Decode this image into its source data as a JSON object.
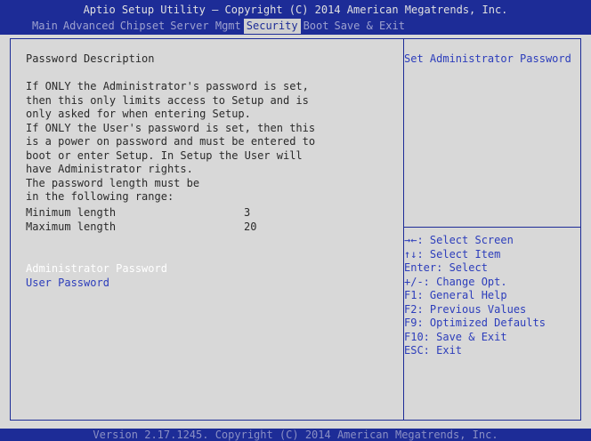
{
  "header": {
    "title": "Aptio Setup Utility – Copyright (C) 2014 American Megatrends, Inc."
  },
  "menu": {
    "items": [
      {
        "label": "Main"
      },
      {
        "label": "Advanced"
      },
      {
        "label": "Chipset"
      },
      {
        "label": "Server Mgmt"
      },
      {
        "label": "Security",
        "active": true
      },
      {
        "label": "Boot"
      },
      {
        "label": "Save & Exit"
      }
    ]
  },
  "main": {
    "heading": "Password Description",
    "description": "If ONLY the Administrator's password is set,\nthen this only limits access to Setup and is\nonly asked for when entering Setup.\nIf ONLY the User's password is set, then this\nis a power on password and must be entered to\nboot or enter Setup. In Setup the User will\nhave Administrator rights.\nThe password length must be\nin the following range:",
    "min_length_label": "Minimum length",
    "min_length_value": "3",
    "max_length_label": "Maximum length",
    "max_length_value": "20",
    "admin_password_label": "Administrator Password",
    "user_password_label": "User Password"
  },
  "help": {
    "text": "Set Administrator Password",
    "keys": "→←: Select Screen\n↑↓: Select Item\nEnter: Select\n+/-: Change Opt.\nF1: General Help\nF2: Previous Values\nF9: Optimized Defaults\nF10: Save & Exit\nESC: Exit"
  },
  "footer": {
    "text": "Version 2.17.1245. Copyright (C) 2014 American Megatrends, Inc."
  },
  "colors": {
    "bar_blue": "#1d2c97",
    "panel_gray": "#d8d8d8",
    "highlight_text": "#ffffff",
    "option_blue": "#2c3dbb"
  }
}
